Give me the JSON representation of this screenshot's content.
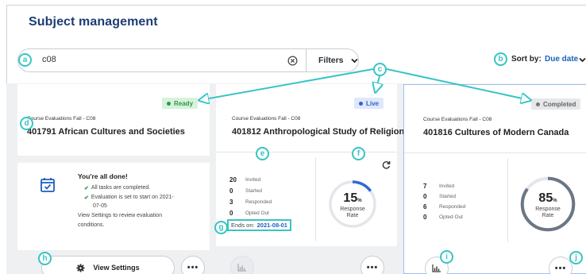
{
  "page": {
    "title": "Subject management"
  },
  "search": {
    "value": "c08",
    "filters_label": "Filters"
  },
  "sort": {
    "label": "Sort by:",
    "value": "Due date"
  },
  "callouts": [
    "a",
    "b",
    "c",
    "d",
    "e",
    "f",
    "g",
    "h",
    "i",
    "j"
  ],
  "cards": [
    {
      "status": "Ready",
      "status_color": "#2e9a45",
      "status_bg": "#d7f2db",
      "course_label": "Course Evaluations Fall - C08",
      "course_title": "401791 African Cultures and Societies",
      "done_title": "You're all done!",
      "done_items": [
        "All tasks are completed.",
        "Evaluation is set to start on 2021-",
        "07-05"
      ],
      "done_note_1": "View Settings to review evaluation",
      "done_note_2": "conditions.",
      "view_settings_label": "View Settings",
      "more_label": "•••"
    },
    {
      "status": "Live",
      "status_color": "#3561c4",
      "status_bg": "#dfe8fb",
      "course_label": "Course Evaluations Fall - C08",
      "course_title": "401812 Anthropological Study of Religion",
      "stats": [
        {
          "num": "20",
          "label": "Invited"
        },
        {
          "num": "0",
          "label": "Started"
        },
        {
          "num": "3",
          "label": "Responded"
        },
        {
          "num": "0",
          "label": "Opted Out"
        }
      ],
      "rate_value": "15",
      "rate_unit": "%",
      "rate_label_1": "Response",
      "rate_label_2": "Rate",
      "rate_fraction": 0.15,
      "ends_label": "Ends on:",
      "ends_date": "2021-08-01",
      "more_label": "•••"
    },
    {
      "status": "Completed",
      "status_color": "#666666",
      "status_bg": "#e6e7e9",
      "course_label": "Course Evaluations Fall - C08",
      "course_title": "401816 Cultures of Modern Canada",
      "stats": [
        {
          "num": "7",
          "label": "Invited"
        },
        {
          "num": "0",
          "label": "Started"
        },
        {
          "num": "6",
          "label": "Responded"
        },
        {
          "num": "0",
          "label": "Opted Out"
        }
      ],
      "rate_value": "85",
      "rate_unit": "%",
      "rate_label_1": "Response",
      "rate_label_2": "Rate",
      "rate_fraction": 0.85,
      "more_label": "•••"
    }
  ],
  "icons": [
    "clear-icon",
    "chevron-down-icon",
    "calendar-check-icon",
    "check-icon",
    "gear-icon",
    "refresh-icon",
    "bar-chart-icon",
    "more-icon"
  ],
  "colors": {
    "accent": "#1f5fbf",
    "title": "#1c3d72",
    "callout": "#38c4c4",
    "ring_progress": "#2e6bd6",
    "ring_track": "#e3e6ea",
    "ring_complete": "#6b7785"
  }
}
